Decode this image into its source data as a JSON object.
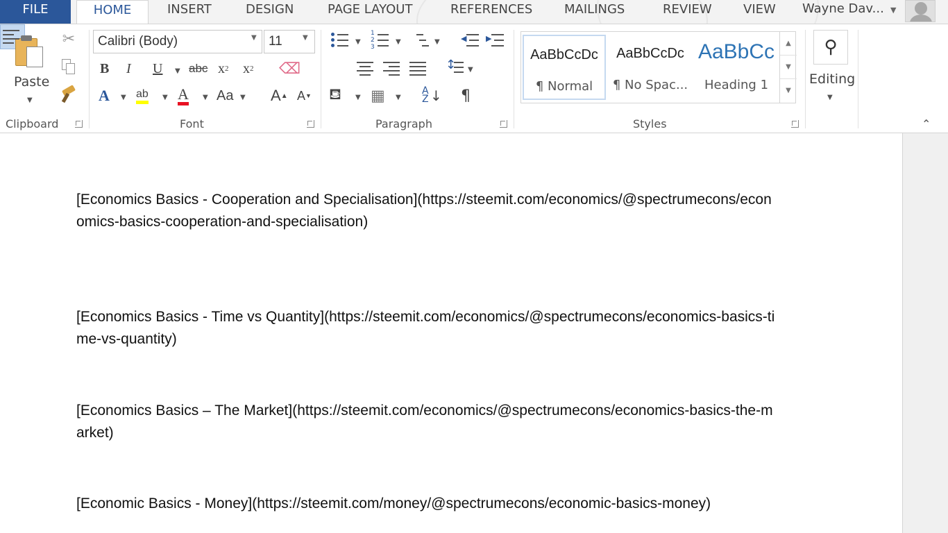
{
  "tabs": {
    "file": "FILE",
    "home": "HOME",
    "insert": "INSERT",
    "design": "DESIGN",
    "page_layout": "PAGE LAYOUT",
    "references": "REFERENCES",
    "mailings": "MAILINGS",
    "review": "REVIEW",
    "view": "VIEW"
  },
  "user": {
    "name": "Wayne Dav..."
  },
  "clipboard": {
    "paste_label": "Paste",
    "group_label": "Clipboard"
  },
  "font": {
    "name": "Calibri (Body)",
    "size": "11",
    "group_label": "Font",
    "case_label": "Aa"
  },
  "paragraph": {
    "group_label": "Paragraph"
  },
  "styles": {
    "group_label": "Styles",
    "items": [
      {
        "sample": "AaBbCcDc",
        "name": "¶ Normal"
      },
      {
        "sample": "AaBbCcDc",
        "name": "¶ No Spac..."
      },
      {
        "sample": "AaBbCc",
        "name": "Heading 1"
      }
    ]
  },
  "editing": {
    "label": "Editing"
  },
  "colors": {
    "accent": "#2b579a",
    "highlight": "#ffff00",
    "font_color": "#e81123",
    "heading": "#2e74b5"
  },
  "document": {
    "paragraphs": [
      "[Economics Basics - Cooperation and Specialisation](https://steemit.com/economics/@spectrumecons/economics-basics-cooperation-and-specialisation)",
      "[Economics Basics - Time vs Quantity](https://steemit.com/economics/@spectrumecons/economics-basics-time-vs-quantity)",
      "[Economics Basics – The Market](https://steemit.com/economics/@spectrumecons/economics-basics-the-market)",
      "[Economic Basics - Money](https://steemit.com/money/@spectrumecons/economic-basics-money)"
    ]
  }
}
